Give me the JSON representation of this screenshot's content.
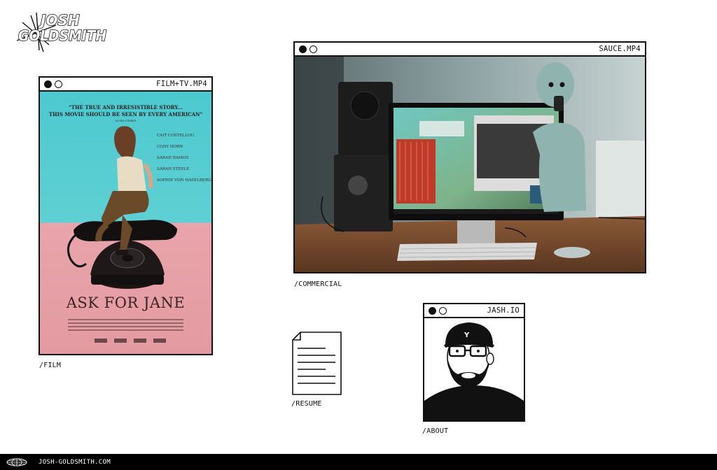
{
  "logo": {
    "line1": "JOSH",
    "line2": "GOLDSMITH",
    "icon": "starburst-logo-icon"
  },
  "windows": {
    "film": {
      "title": "FILM+TV.MP4",
      "poster": {
        "quote_line1": "\"THE TRUE AND IRRESISTIBLE STORY...",
        "quote_line2": "THIS MOVIE SHOULD BE SEEN BY EVERY AMERICAN\"",
        "quote_source": "GLORIA STEINEM",
        "cast": [
          "CAIT COSTELLOU",
          "CODY HORN",
          "SARAH RAMOS",
          "SARAH STEELE",
          "SOPHIE VON HASELBERG"
        ],
        "movie_title": "ASK FOR JANE"
      }
    },
    "sauce": {
      "title": "SAUCE.MP4"
    },
    "about": {
      "title": "JASH.IO"
    }
  },
  "labels": {
    "film": "/FILM",
    "commercial": "/COMMERCIAL",
    "resume": "/RESUME",
    "about": "/ABOUT"
  },
  "footer": {
    "text": "JOSH-GOLDSMITH.COM",
    "icon": "globe-icon"
  },
  "colors": {
    "ink": "#111111",
    "poster_teal": "#4cc9cf",
    "poster_pink": "#e8a5ab",
    "footer_bg": "#000000"
  }
}
